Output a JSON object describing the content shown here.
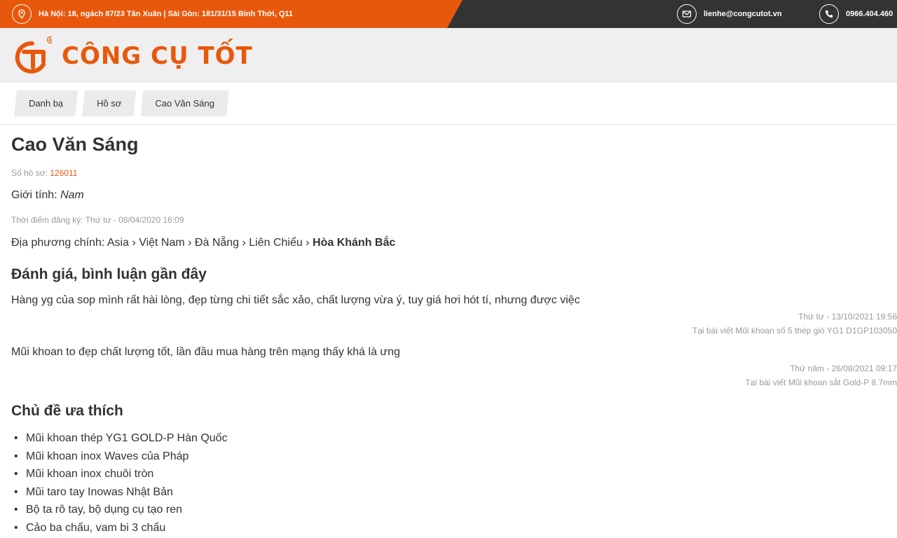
{
  "topbar": {
    "address": "Hà Nội: 18, ngách 87/23 Tân Xuân | Sài Gòn: 181/31/15 Bình Thới, Q11",
    "address_icon": "location-pin-icon",
    "email": "lienhe@congcutot.vn",
    "email_icon": "mail-icon",
    "phone": "0966.404.460",
    "phone_icon": "phone-icon",
    "orange": "#e8580c",
    "dark": "#333333"
  },
  "header": {
    "logo_text": "CÔNG CỤ TỐT",
    "logo_icon": "brand-logo-icon"
  },
  "breadcrumb": [
    "Danh bạ",
    "Hồ sơ",
    "Cao Văn Sáng"
  ],
  "profile": {
    "name": "Cao Văn Sáng",
    "id_label": "Số hồ sơ:",
    "id_value": "126011",
    "gender_label": "Giới tính:",
    "gender_value": "Nam",
    "registered": "Thời điểm đăng ký: Thứ tư - 08/04/2020 16:09",
    "location_label": "Địa phương chính: Asia › Việt Nam › Đà Nẵng › Liên Chiểu ›",
    "location_last": "Hòa Khánh Bắc"
  },
  "reviews": {
    "title": "Đánh giá, bình luận gần đây",
    "items": [
      {
        "text": "Hàng yg của sop mình rất hài lòng, đẹp từng chi tiết sắc xảo, chất lượng vừa ý, tuy giá hơi hót tí, nhưng được việc",
        "date": "Thứ tư - 13/10/2021 19:56",
        "post": "Tại bài viết Mũi khoan số 5 thép gió YG1 D1GP103050"
      },
      {
        "text": "Mũi khoan to đẹp chất lượng tốt, lần đầu mua hàng trên mạng thấy khá là ưng",
        "date": "Thứ năm - 26/08/2021 09:17",
        "post": "Tại bài viết Mũi khoan sắt Gold-P 8.7mm"
      }
    ]
  },
  "topics": {
    "title": "Chủ đề ưa thích",
    "items": [
      "Mũi khoan thép YG1 GOLD-P Hàn Quốc",
      "Mũi khoan inox Waves của Pháp",
      "Mũi khoan inox chuôi tròn",
      "Mũi taro tay Inowas Nhật Bản",
      "Bộ ta rô tay, bộ dụng cụ tạo ren",
      "Cảo ba chấu, vam bi 3 chấu"
    ]
  }
}
